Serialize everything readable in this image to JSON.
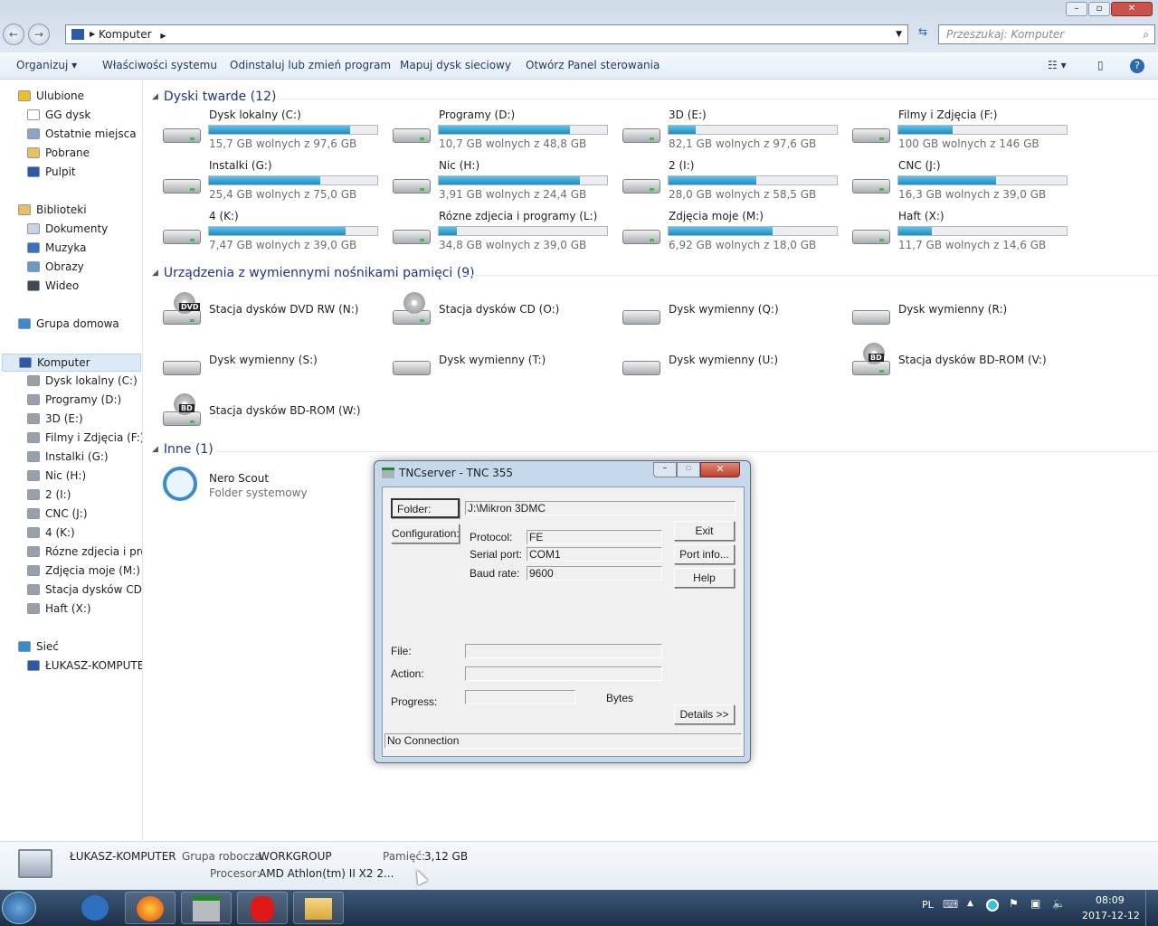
{
  "window": {
    "address_root": "Komputer",
    "search_placeholder": "Przeszukaj: Komputer"
  },
  "toolbar": {
    "organize": "Organizuj ▾",
    "system_properties": "Właściwości systemu",
    "uninstall": "Odinstaluj lub zmień program",
    "map_drive": "Mapuj dysk sieciowy",
    "control_panel": "Otwórz Panel sterowania"
  },
  "sidebar": {
    "items": [
      {
        "label": "Ulubione",
        "indent": 0,
        "icon": "star-icon",
        "color": "#f0c020"
      },
      {
        "label": "GG dysk",
        "indent": 1,
        "icon": "folder-icon",
        "color": "#ffffff"
      },
      {
        "label": "Ostatnie miejsca",
        "indent": 1,
        "icon": "recent-icon",
        "color": "#8aa4c8"
      },
      {
        "label": "Pobrane",
        "indent": 1,
        "icon": "downloads-icon",
        "color": "#e8c060"
      },
      {
        "label": "Pulpit",
        "indent": 1,
        "icon": "desktop-icon",
        "color": "#2c5aa8"
      },
      {
        "label": "",
        "indent": 0
      },
      {
        "label": "Biblioteki",
        "indent": 0,
        "icon": "library-icon",
        "color": "#e8c060"
      },
      {
        "label": "Dokumenty",
        "indent": 1,
        "icon": "documents-icon",
        "color": "#c8d4e4"
      },
      {
        "label": "Muzyka",
        "indent": 1,
        "icon": "music-icon",
        "color": "#3a70c0"
      },
      {
        "label": "Obrazy",
        "indent": 1,
        "icon": "pictures-icon",
        "color": "#6a9ac8"
      },
      {
        "label": "Wideo",
        "indent": 1,
        "icon": "video-icon",
        "color": "#404850"
      },
      {
        "label": "",
        "indent": 0
      },
      {
        "label": "Grupa domowa",
        "indent": 0,
        "icon": "homegroup-icon",
        "color": "#3a8ad0"
      },
      {
        "label": "",
        "indent": 0
      },
      {
        "label": "Komputer",
        "indent": 0,
        "icon": "computer-icon",
        "color": "#2c5aa8",
        "selected": true
      },
      {
        "label": "Dysk lokalny (C:)",
        "indent": 1,
        "icon": "drive-icon",
        "color": "#9aa0a8"
      },
      {
        "label": "Programy (D:)",
        "indent": 1,
        "icon": "drive-icon",
        "color": "#9aa0a8"
      },
      {
        "label": "3D (E:)",
        "indent": 1,
        "icon": "drive-icon",
        "color": "#9aa0a8"
      },
      {
        "label": "Filmy i Zdjęcia  (F:)",
        "indent": 1,
        "icon": "drive-icon",
        "color": "#9aa0a8"
      },
      {
        "label": "Instalki (G:)",
        "indent": 1,
        "icon": "drive-icon",
        "color": "#9aa0a8"
      },
      {
        "label": "Nic (H:)",
        "indent": 1,
        "icon": "drive-icon",
        "color": "#9aa0a8"
      },
      {
        "label": "2 (I:)",
        "indent": 1,
        "icon": "drive-icon",
        "color": "#9aa0a8"
      },
      {
        "label": "CNC (J:)",
        "indent": 1,
        "icon": "drive-icon",
        "color": "#9aa0a8"
      },
      {
        "label": "4 (K:)",
        "indent": 1,
        "icon": "drive-icon",
        "color": "#9aa0a8"
      },
      {
        "label": "Rózne zdjecia i prog",
        "indent": 1,
        "icon": "drive-icon",
        "color": "#9aa0a8"
      },
      {
        "label": "Zdjęcia moje (M:)",
        "indent": 1,
        "icon": "drive-icon",
        "color": "#9aa0a8"
      },
      {
        "label": "Stacja dysków CD (C",
        "indent": 1,
        "icon": "cd-drive-icon",
        "color": "#9aa0a8"
      },
      {
        "label": "Haft (X:)",
        "indent": 1,
        "icon": "drive-icon",
        "color": "#9aa0a8"
      },
      {
        "label": "",
        "indent": 0
      },
      {
        "label": "Sieć",
        "indent": 0,
        "icon": "network-icon",
        "color": "#3a8ad0"
      },
      {
        "label": "ŁUKASZ-KOMPUTER",
        "indent": 1,
        "icon": "computer-icon",
        "color": "#2c5aa8"
      }
    ]
  },
  "groups": {
    "hard_drives": {
      "title": "Dyski twarde (12)",
      "items": [
        {
          "name": "Dysk lokalny (C:)",
          "free": "15,7 GB wolnych z 97,6 GB",
          "used_fraction": 0.84
        },
        {
          "name": "Programy (D:)",
          "free": "10,7 GB wolnych z 48,8 GB",
          "used_fraction": 0.78
        },
        {
          "name": "3D (E:)",
          "free": "82,1 GB wolnych z 97,6 GB",
          "used_fraction": 0.16
        },
        {
          "name": "Filmy i Zdjęcia  (F:)",
          "free": "100 GB wolnych z 146 GB",
          "used_fraction": 0.32
        },
        {
          "name": "Instalki (G:)",
          "free": "25,4 GB wolnych z 75,0 GB",
          "used_fraction": 0.66
        },
        {
          "name": "Nic (H:)",
          "free": "3,91 GB wolnych z 24,4 GB",
          "used_fraction": 0.84
        },
        {
          "name": "2 (I:)",
          "free": "28,0 GB wolnych z 58,5 GB",
          "used_fraction": 0.52
        },
        {
          "name": "CNC (J:)",
          "free": "16,3 GB wolnych z 39,0 GB",
          "used_fraction": 0.58
        },
        {
          "name": "4 (K:)",
          "free": "7,47 GB wolnych z 39,0 GB",
          "used_fraction": 0.81
        },
        {
          "name": "Rózne zdjecia i programy (L:)",
          "free": "34,8 GB wolnych z 39,0 GB",
          "used_fraction": 0.11
        },
        {
          "name": "Zdjęcia moje (M:)",
          "free": "6,92 GB wolnych z 18,0 GB",
          "used_fraction": 0.62
        },
        {
          "name": "Haft (X:)",
          "free": "11,7 GB wolnych z 14,6 GB",
          "used_fraction": 0.2
        }
      ]
    },
    "removable": {
      "title": "Urządzenia z wymiennymi nośnikami pamięci (9)",
      "items": [
        {
          "name": "Stacja dysków DVD RW (N:)",
          "badge": "DVD"
        },
        {
          "name": "Stacja dysków CD (O:)",
          "badge": "CD"
        },
        {
          "name": "Dysk wymienny (Q:)"
        },
        {
          "name": "Dysk wymienny (R:)"
        },
        {
          "name": "Dysk wymienny (S:)"
        },
        {
          "name": "Dysk wymienny (T:)"
        },
        {
          "name": "Dysk wymienny (U:)"
        },
        {
          "name": "Stacja dysków BD-ROM (V:)",
          "badge": "BD"
        },
        {
          "name": "Stacja dysków BD-ROM (W:)",
          "badge": "BD"
        }
      ]
    },
    "other": {
      "title": "Inne (1)",
      "items": [
        {
          "name": "Nero Scout",
          "sub": "Folder systemowy"
        }
      ]
    }
  },
  "details": {
    "computer": "ŁUKASZ-KOMPUTER",
    "workgroup_label": "Grupa robocza:",
    "workgroup": "WORKGROUP",
    "memory_label": "Pamięć:",
    "memory": "3,12 GB",
    "cpu_label": "Procesor:",
    "cpu": "AMD Athlon(tm) II X2 2..."
  },
  "dialog": {
    "title": "TNCserver - TNC 355",
    "folder_btn": "Folder:",
    "folder": "J:\\Mikron 3DMC",
    "config_btn": "Configuration:",
    "protocol_label": "Protocol:",
    "protocol": "FE",
    "port_label": "Serial port:",
    "port": "COM1",
    "baud_label": "Baud rate:",
    "baud": "9600",
    "exit": "Exit",
    "port_info": "Port info...",
    "help": "Help",
    "file_label": "File:",
    "action_label": "Action:",
    "progress_label": "Progress:",
    "bytes": "Bytes",
    "details_btn": "Details >>",
    "status": "No Connection"
  },
  "tray": {
    "lang": "PL",
    "time": "08:09",
    "date": "2017-12-12"
  }
}
